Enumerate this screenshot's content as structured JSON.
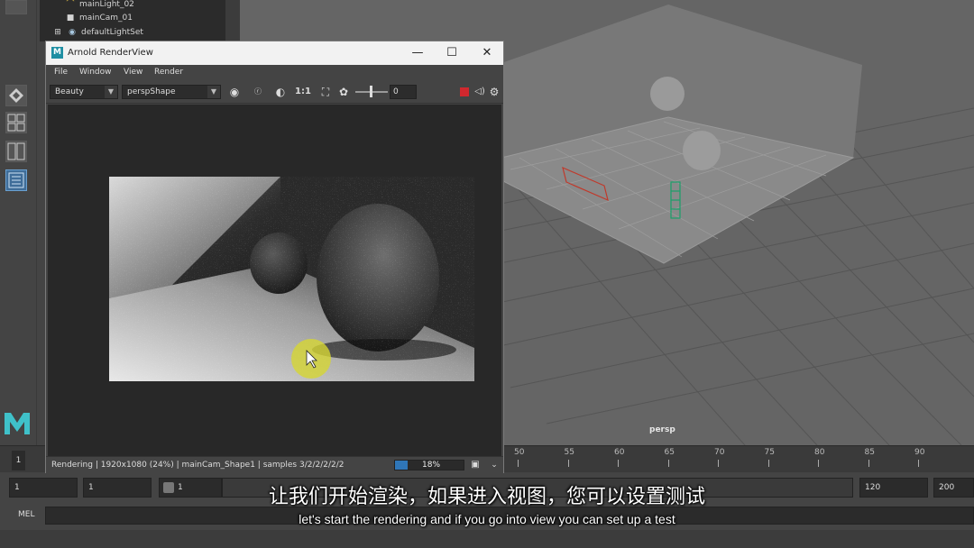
{
  "outliner": {
    "items": [
      {
        "label": "mainLight_02",
        "icon": "light-icon"
      },
      {
        "label": "mainCam_01",
        "icon": "camera-icon"
      },
      {
        "label": "defaultLightSet",
        "icon": "set-icon"
      }
    ]
  },
  "viewport": {
    "camera_label": "persp"
  },
  "render_view": {
    "title": "Arnold RenderView",
    "window_controls": {
      "minimize": "—",
      "maximize": "☐",
      "close": "✕"
    },
    "menu": [
      "File",
      "Window",
      "View",
      "Render"
    ],
    "toolbar": {
      "aov_value": "Beauty",
      "camera_value": "perspShape",
      "ratio_label": "1:1",
      "exposure_value": "0"
    },
    "status": {
      "text": "Rendering | 1920x1080 (24%) | mainCam_Shape1 | samples 3/2/2/2/2/2",
      "progress_label": "18%",
      "progress_value": 0.18
    }
  },
  "timeline": {
    "current_frame": "1",
    "ticks": [
      "50",
      "55",
      "60",
      "65",
      "70",
      "75",
      "80",
      "85",
      "90"
    ]
  },
  "range": {
    "start": "1",
    "playback_start": "1",
    "slider_value": "1",
    "playback_end": "120",
    "end": "200"
  },
  "command_line": {
    "label": "MEL"
  },
  "subtitles": {
    "chinese": "让我们开始渲染，如果进入视图，您可以设置测试",
    "english": "let's start the rendering and if you go into view you can set up a test"
  },
  "colors": {
    "accent": "#3f6d99",
    "progress": "#2f76b8",
    "record": "#d0282e",
    "maya_logo": "#3fc1c9"
  }
}
